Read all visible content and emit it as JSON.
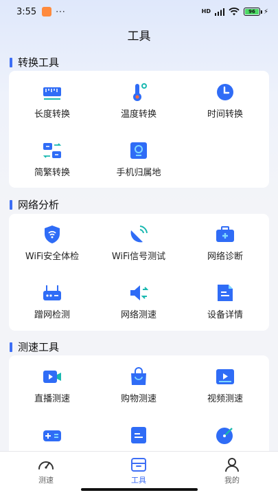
{
  "status_bar": {
    "time": "3:55",
    "dots": "···",
    "network": "HD",
    "battery": "96"
  },
  "header": {
    "title": "工具"
  },
  "sections": [
    {
      "title": "转换工具",
      "items": [
        {
          "label": "长度转换",
          "icon": "ruler-icon"
        },
        {
          "label": "温度转换",
          "icon": "thermometer-icon"
        },
        {
          "label": "时间转换",
          "icon": "clock-icon"
        },
        {
          "label": "简繁转换",
          "icon": "translate-icon"
        },
        {
          "label": "手机归属地",
          "icon": "phone-location-icon"
        }
      ]
    },
    {
      "title": "网络分析",
      "items": [
        {
          "label": "WiFi安全体检",
          "icon": "wifi-shield-icon"
        },
        {
          "label": "WiFi信号测试",
          "icon": "signal-dish-icon"
        },
        {
          "label": "网络诊断",
          "icon": "medical-kit-icon"
        },
        {
          "label": "蹭网检测",
          "icon": "router-icon"
        },
        {
          "label": "网络测速",
          "icon": "speaker-speed-icon"
        },
        {
          "label": "设备详情",
          "icon": "document-icon"
        }
      ]
    },
    {
      "title": "测速工具",
      "items": [
        {
          "label": "直播测速",
          "icon": "video-camera-icon"
        },
        {
          "label": "购物测速",
          "icon": "shopping-bag-icon"
        },
        {
          "label": "视频测速",
          "icon": "video-player-icon"
        },
        {
          "label": "",
          "icon": "gamepad-icon"
        },
        {
          "label": "",
          "icon": "file-icon"
        },
        {
          "label": "",
          "icon": "radar-icon"
        }
      ]
    }
  ],
  "tabbar": {
    "tabs": [
      {
        "label": "测速",
        "icon": "speedometer-icon",
        "active": false
      },
      {
        "label": "工具",
        "icon": "toolbox-icon",
        "active": true
      },
      {
        "label": "我的",
        "icon": "user-icon",
        "active": false
      }
    ]
  },
  "colors": {
    "accent": "#3d6ef5",
    "icon_blue": "#2f6cf6",
    "background": "#f3f4f8"
  }
}
